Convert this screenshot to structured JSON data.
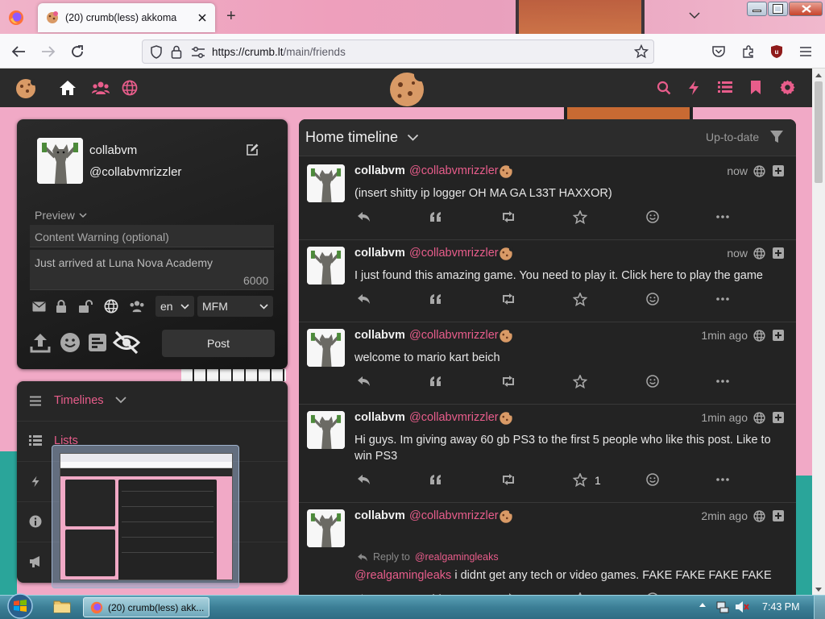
{
  "browser": {
    "tab_title": "(20) crumb(less) akkoma",
    "new_tab": "+",
    "url_host": "https://crumb.lt",
    "url_path": "/main/friends"
  },
  "app": {
    "accent": "#e85d8b"
  },
  "composer": {
    "display_name": "collabvm",
    "username": "@collabvmrizzler",
    "preview_label": "Preview",
    "cw_placeholder": "Content Warning (optional)",
    "status_text": "Just arrived at Luna Nova Academy",
    "char_count": "6000",
    "language": "en",
    "format": "MFM",
    "post_button": "Post"
  },
  "nav_panel": {
    "timelines_label": "Timelines",
    "lists_label": "Lists"
  },
  "timeline": {
    "title": "Home timeline",
    "status": "Up-to-date",
    "posts": [
      {
        "name": "collabvm",
        "handle": "@collabvmrizzler",
        "time": "now",
        "text": "(insert shitty ip logger OH MA GA L33T HAXXOR)",
        "fav_count": ""
      },
      {
        "name": "collabvm",
        "handle": "@collabvmrizzler",
        "time": "now",
        "text": "I just found this amazing game. You need to play it. Click here to play the game",
        "fav_count": ""
      },
      {
        "name": "collabvm",
        "handle": "@collabvmrizzler",
        "time": "1min ago",
        "text": "welcome to mario kart beich",
        "fav_count": ""
      },
      {
        "name": "collabvm",
        "handle": "@collabvmrizzler",
        "time": "1min ago",
        "text": "Hi guys. Im giving away 60 gb PS3 to the first 5 people who like this post. Like to win PS3",
        "fav_count": "1"
      },
      {
        "name": "collabvm",
        "handle": "@collabvmrizzler",
        "time": "2min ago",
        "reply_label": "Reply to",
        "reply_handle": "@realgamingleaks",
        "mention": "@realgamingleaks",
        "text": " i didnt get any tech or video games. FAKE FAKE FAKE FAKE",
        "fav_count": ""
      }
    ]
  },
  "taskbar": {
    "task_label": "(20) crumb(less) akk...",
    "clock": "7:43 PM"
  }
}
